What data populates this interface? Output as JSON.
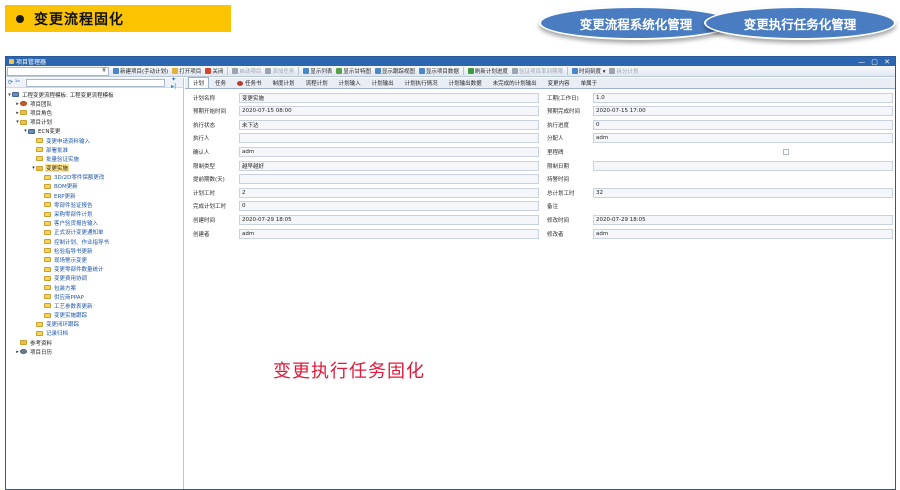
{
  "slide": {
    "title": "变更流程固化",
    "pill_left": "变更流程系统化管理",
    "pill_right": "变更执行任务化管理",
    "overlay_text": "变更执行任务固化"
  },
  "window": {
    "title": "项目管理器",
    "controls": "— ▢ ✕"
  },
  "toolbar": {
    "combo_arrow": "¥",
    "buttons": [
      {
        "label": "新建项目(手动计划)",
        "icon_color": "#4a86c8",
        "enabled": true
      },
      {
        "label": "打开项目",
        "icon_color": "#e2b13c",
        "enabled": true
      },
      {
        "label": "关闭",
        "icon_color": "#d9432b",
        "enabled": true
      },
      {
        "label": "启动项目",
        "icon_color": "#9aa3ae",
        "enabled": false
      },
      {
        "label": "添加任务",
        "icon_color": "#9aa3ae",
        "enabled": false
      },
      {
        "label": "显示列表",
        "icon_color": "#4a86c8",
        "enabled": true
      },
      {
        "label": "显示甘特图",
        "icon_color": "#5aa04a",
        "enabled": true
      },
      {
        "label": "显示跟踪视图",
        "icon_color": "#4a86c8",
        "enabled": true
      },
      {
        "label": "显示项目数据",
        "icon_color": "#4a86c8",
        "enabled": true
      },
      {
        "label": "刷新计划进度",
        "icon_color": "#3f9a3f",
        "enabled": true
      },
      {
        "label": "验证项目率到期限",
        "icon_color": "#9aa3ae",
        "enabled": false
      },
      {
        "label": "时间刻度 ▾",
        "icon_color": "#4a86c8",
        "enabled": true
      },
      {
        "label": "拆分计划",
        "icon_color": "#9aa3ae",
        "enabled": false
      }
    ]
  },
  "tree": {
    "search_icons": "⟳ ¹ᵃ",
    "search_buttons": "✦ ▸|",
    "items": [
      {
        "label": "工程变更流程模板: 工程变更流程模板",
        "level": 0,
        "exp": "▾",
        "icon": "sys"
      },
      {
        "label": "项目团队",
        "level": 1,
        "exp": "▸",
        "icon": "grp"
      },
      {
        "label": "项目角色",
        "level": 1,
        "exp": "▸",
        "icon": "folder"
      },
      {
        "label": "项目计划",
        "level": 1,
        "exp": "▾",
        "icon": "folder"
      },
      {
        "label": "ECN变更",
        "level": 2,
        "exp": "▾",
        "icon": "sys"
      },
      {
        "label": "变更申请资料输入",
        "level": 3,
        "exp": "",
        "icon": "doc",
        "blue": true
      },
      {
        "label": "部署批准",
        "level": 3,
        "exp": "",
        "icon": "doc",
        "blue": true
      },
      {
        "label": "批量验证实施",
        "level": 3,
        "exp": "",
        "icon": "doc",
        "blue": true
      },
      {
        "label": "变更实施",
        "level": 3,
        "exp": "▾",
        "icon": "folder",
        "selected": true
      },
      {
        "label": "3D/2D零件保额更改",
        "level": 4,
        "exp": "",
        "icon": "doc",
        "blue": true
      },
      {
        "label": "BOM更新",
        "level": 4,
        "exp": "",
        "icon": "doc",
        "blue": true
      },
      {
        "label": "ERP更新",
        "level": 4,
        "exp": "",
        "icon": "doc",
        "blue": true
      },
      {
        "label": "零部件验证报告",
        "level": 4,
        "exp": "",
        "icon": "doc",
        "blue": true
      },
      {
        "label": "采购零部件计划",
        "level": 4,
        "exp": "",
        "icon": "doc",
        "blue": true
      },
      {
        "label": "客户验货报告输入",
        "level": 4,
        "exp": "",
        "icon": "doc",
        "blue": true
      },
      {
        "label": "正式设计变更通知单",
        "level": 4,
        "exp": "",
        "icon": "doc",
        "blue": true
      },
      {
        "label": "控制计划、作业指导书",
        "level": 4,
        "exp": "",
        "icon": "doc",
        "blue": true
      },
      {
        "label": "检验指导书更新",
        "level": 4,
        "exp": "",
        "icon": "doc",
        "blue": true
      },
      {
        "label": "现场警示变更",
        "level": 4,
        "exp": "",
        "icon": "doc",
        "blue": true
      },
      {
        "label": "变更零部件数量统计",
        "level": 4,
        "exp": "",
        "icon": "doc",
        "blue": true
      },
      {
        "label": "变更费用协调",
        "level": 4,
        "exp": "",
        "icon": "doc",
        "blue": true
      },
      {
        "label": "包装方案",
        "level": 4,
        "exp": "",
        "icon": "doc",
        "blue": true
      },
      {
        "label": "供应商PPAP",
        "level": 4,
        "exp": "",
        "icon": "doc",
        "blue": true
      },
      {
        "label": "工艺参数表更新",
        "level": 4,
        "exp": "",
        "icon": "doc",
        "blue": true
      },
      {
        "label": "变更实施跟踪",
        "level": 4,
        "exp": "",
        "icon": "doc",
        "blue": true
      },
      {
        "label": "变更闭环跟踪",
        "level": 3,
        "exp": "",
        "icon": "doc",
        "blue": true
      },
      {
        "label": "记录归档",
        "level": 3,
        "exp": "",
        "icon": "doc",
        "blue": true
      },
      {
        "label": "参考资料",
        "level": 1,
        "exp": "",
        "icon": "folder"
      },
      {
        "label": "项目日历",
        "level": 1,
        "exp": "▸",
        "icon": "gear"
      }
    ]
  },
  "tabs": [
    {
      "label": "计划",
      "active": true
    },
    {
      "label": "任务",
      "active": false
    },
    {
      "label": "任务书",
      "active": false,
      "icon": true
    },
    {
      "label": "制度计划",
      "active": false
    },
    {
      "label": "流程计划",
      "active": false
    },
    {
      "label": "计划输入",
      "active": false
    },
    {
      "label": "计划输出",
      "active": false
    },
    {
      "label": "计划执行情况",
      "active": false
    },
    {
      "label": "计划输出数据",
      "active": false
    },
    {
      "label": "未完成的计划输出",
      "active": false
    },
    {
      "label": "变更内容",
      "active": false
    },
    {
      "label": "单属于",
      "active": false
    }
  ],
  "form": {
    "left": [
      {
        "label": "计划名称",
        "value": "变更实施"
      },
      {
        "label": "预期开始时间",
        "value": "2020-07-15 08:00"
      },
      {
        "label": "执行状态",
        "value": "未下达"
      },
      {
        "label": "执行人",
        "value": ""
      },
      {
        "label": "确认人",
        "value": "adm"
      },
      {
        "label": "限制类型",
        "value": "越早越好"
      },
      {
        "label": "提前期数(天)",
        "value": ""
      },
      {
        "label": "计划工时",
        "value": "2"
      },
      {
        "label": "完成计划工时",
        "value": "0"
      },
      {
        "label": "创建时间",
        "value": "2020-07-29 18:05"
      },
      {
        "label": "创建者",
        "value": "adm"
      }
    ],
    "right": [
      {
        "label": "工期(工作日)",
        "value": "1.0",
        "type": "box"
      },
      {
        "label": "预期完成时间",
        "value": "2020-07-15 17:00",
        "type": "box"
      },
      {
        "label": "执行进度",
        "value": "0",
        "type": "box"
      },
      {
        "label": "分配人",
        "value": "adm",
        "type": "box"
      },
      {
        "label": "里程碑",
        "value": "",
        "type": "check"
      },
      {
        "label": "限制日期",
        "value": "",
        "type": "box"
      },
      {
        "label": "持警时间",
        "value": "",
        "type": "none"
      },
      {
        "label": "总计划工时",
        "value": "32",
        "type": "box"
      },
      {
        "label": "备注",
        "value": "",
        "type": "none"
      },
      {
        "label": "修改时间",
        "value": "2020-07-29 18:05",
        "type": "box"
      },
      {
        "label": "修改者",
        "value": "adm",
        "type": "box"
      }
    ]
  }
}
